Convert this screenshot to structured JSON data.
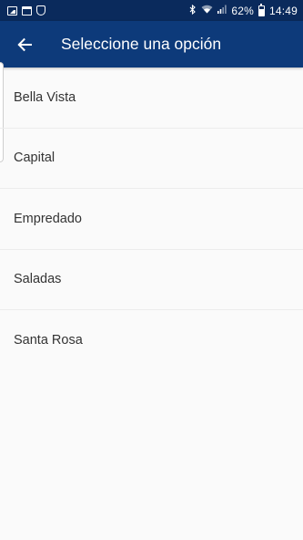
{
  "status_bar": {
    "battery_percent": "62%",
    "battery_level": 0.62,
    "time": "14:49",
    "left_icons": [
      "gallery-icon",
      "calendar-icon",
      "shield-icon"
    ],
    "right_icons": [
      "bluetooth-icon",
      "wifi-icon",
      "signal-icon",
      "battery-icon"
    ]
  },
  "app_bar": {
    "title": "Seleccione una opción",
    "back_icon": "arrow-left-icon",
    "background_color": "#0d3a7a"
  },
  "options": [
    {
      "label": "Bella Vista"
    },
    {
      "label": "Capital"
    },
    {
      "label": "Empredado"
    },
    {
      "label": "Saladas"
    },
    {
      "label": "Santa Rosa"
    }
  ]
}
